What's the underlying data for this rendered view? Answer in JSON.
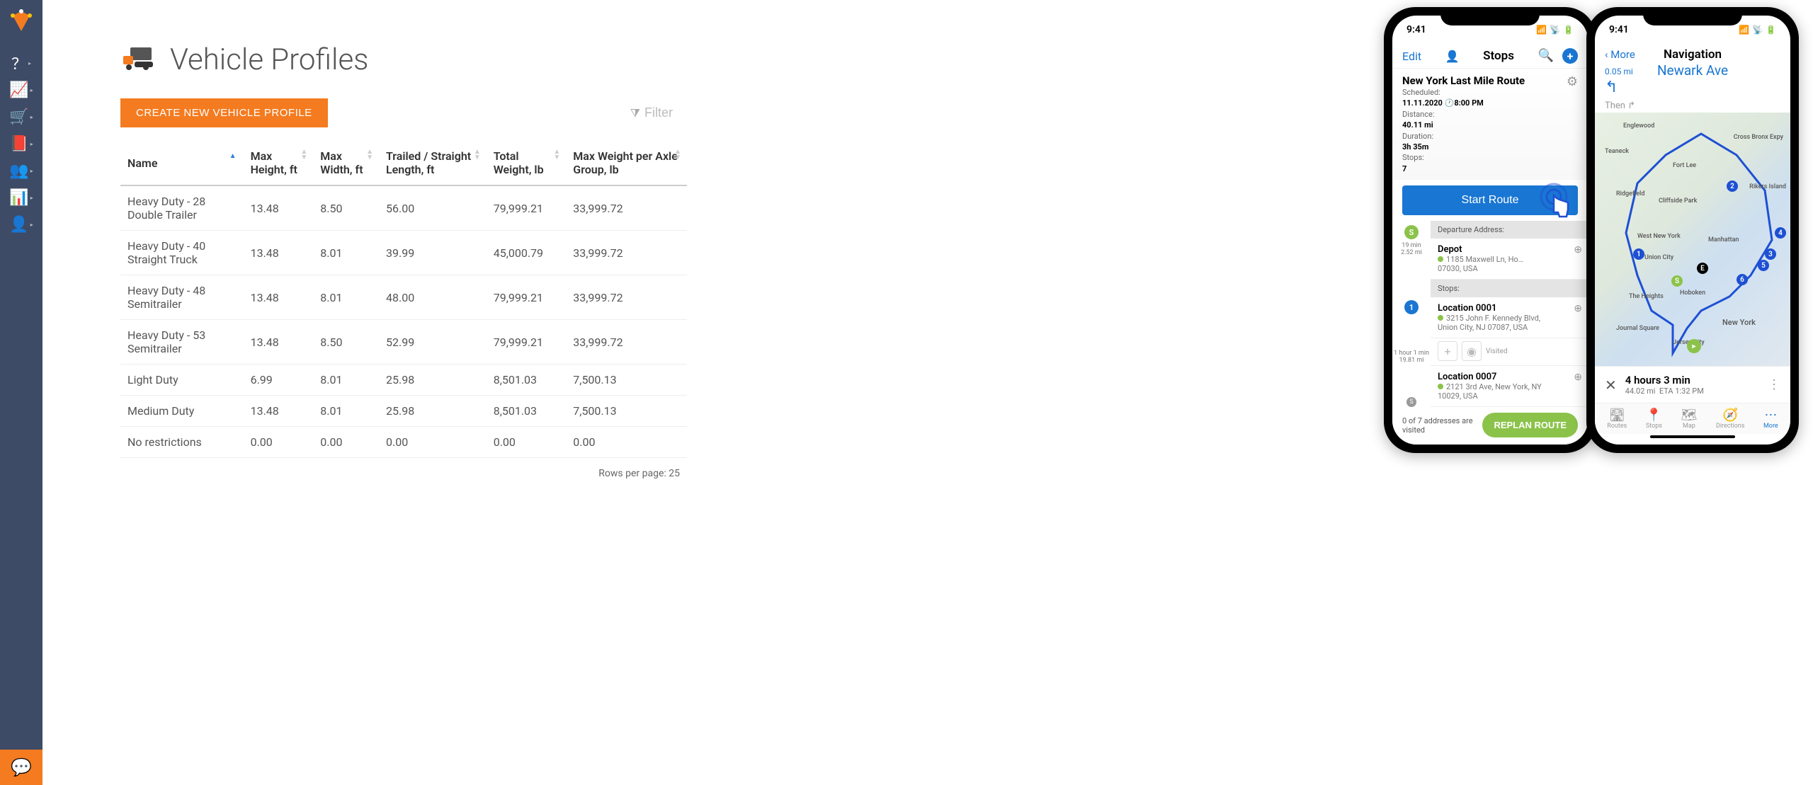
{
  "sidebar": {
    "items": [
      "help",
      "growth",
      "cart",
      "book",
      "team",
      "analytics",
      "user-settings"
    ]
  },
  "page": {
    "title": "Vehicle Profiles",
    "create_btn": "CREATE NEW VEHICLE PROFILE",
    "filter_placeholder": "Filter",
    "rows_per_page_label": "Rows per page:",
    "rows_per_page_value": "25"
  },
  "table": {
    "columns": [
      "Name",
      "Max Height, ft",
      "Max Width, ft",
      "Trailed / Straight Length, ft",
      "Total Weight, lb",
      "Max Weight per Axle Group, lb"
    ],
    "rows": [
      {
        "name": "Heavy Duty - 28 Double Trailer",
        "h": "13.48",
        "w": "8.50",
        "l": "56.00",
        "tw": "79,999.21",
        "aw": "33,999.72"
      },
      {
        "name": "Heavy Duty - 40 Straight Truck",
        "h": "13.48",
        "w": "8.01",
        "l": "39.99",
        "tw": "45,000.79",
        "aw": "33,999.72"
      },
      {
        "name": "Heavy Duty - 48 Semitrailer",
        "h": "13.48",
        "w": "8.01",
        "l": "48.00",
        "tw": "79,999.21",
        "aw": "33,999.72"
      },
      {
        "name": "Heavy Duty - 53 Semitrailer",
        "h": "13.48",
        "w": "8.50",
        "l": "52.99",
        "tw": "79,999.21",
        "aw": "33,999.72"
      },
      {
        "name": "Light Duty",
        "h": "6.99",
        "w": "8.01",
        "l": "25.98",
        "tw": "8,501.03",
        "aw": "7,500.13"
      },
      {
        "name": "Medium Duty",
        "h": "13.48",
        "w": "8.01",
        "l": "25.98",
        "tw": "8,501.03",
        "aw": "7,500.13"
      },
      {
        "name": "No restrictions",
        "h": "0.00",
        "w": "0.00",
        "l": "0.00",
        "tw": "0.00",
        "aw": "0.00"
      }
    ]
  },
  "phoneA": {
    "time": "9:41",
    "edit": "Edit",
    "title": "Stops",
    "route_name": "New York Last Mile Route",
    "scheduled_label": "Scheduled:",
    "scheduled": "11.11.2020",
    "scheduled_time": "8:00 PM",
    "distance_label": "Distance:",
    "distance": "40.11 mi",
    "duration_label": "Duration:",
    "duration": "3h 35m",
    "stops_count_label": "Stops:",
    "stops_count": "7",
    "start_route": "Start Route",
    "departure_label": "Departure Address:",
    "depot_name": "Depot",
    "depot_addr1": "1185 Maxwell Ln, Ho…",
    "depot_addr2": "07030, USA",
    "stops_label": "Stops:",
    "leg1_time": "19 min",
    "leg1_dist": "2.52 mi",
    "leg2_time": "1 hour 1 min",
    "leg2_dist": "19.81 mi",
    "stop1_name": "Location 0001",
    "stop1_addr1": "3215 John F. Kennedy Blvd,",
    "stop1_addr2": "Union City, NJ 07087, USA",
    "visited_label": "Visited",
    "stop2_name": "Location 0007",
    "stop2_addr1": "2121 3rd Ave, New York, NY",
    "stop2_addr2": "10029, USA",
    "visit_status": "0 of 7 addresses are visited",
    "replan": "REPLAN ROUTE",
    "tabs": [
      "Routes",
      "Stops",
      "Map",
      "Directions",
      "More"
    ]
  },
  "phoneB": {
    "time": "9:41",
    "more": "More",
    "title": "Navigation",
    "next_dist": "0.05 mi",
    "street": "Newark Ave",
    "then": "Then",
    "map_labels": [
      "Englewood",
      "Teaneck",
      "Fort Lee",
      "Ridgefield",
      "Cliffside Park",
      "West New York",
      "Union City",
      "Manhattan",
      "Hoboken",
      "The Heights",
      "New York",
      "Jersey City",
      "Journal Square",
      "Cross Bronx Expy",
      "Rikers Island"
    ],
    "pins": [
      "1",
      "2",
      "3",
      "4",
      "5",
      "6",
      "S",
      "E"
    ],
    "eta_duration": "4 hours 3 min",
    "eta_dist": "44.02 mi",
    "eta_time": "ETA 1:32 PM",
    "tabs": [
      "Routes",
      "Stops",
      "Map",
      "Directions",
      "More"
    ]
  }
}
